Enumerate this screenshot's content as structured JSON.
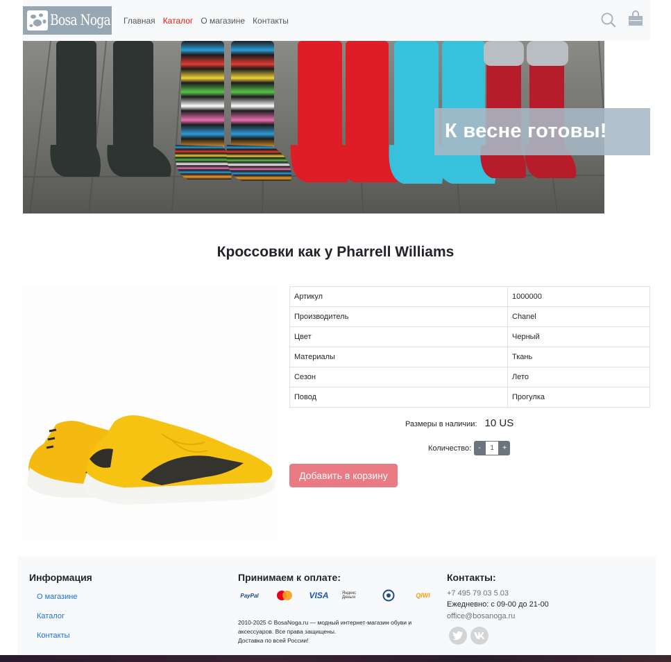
{
  "header": {
    "logo_text": "Bosa Noga",
    "nav": [
      {
        "label": "Главная",
        "active": false
      },
      {
        "label": "Каталог",
        "active": true
      },
      {
        "label": "О магазине",
        "active": false
      },
      {
        "label": "Контакты",
        "active": false
      }
    ],
    "icons": [
      "search-icon",
      "shopping-bag-icon"
    ]
  },
  "banner": {
    "text": "К весне готовы!"
  },
  "product": {
    "title": "Кроссовки как у Pharrell Williams",
    "specs": [
      {
        "key": "Артикул",
        "value": "1000000"
      },
      {
        "key": "Производитель",
        "value": "Chanel"
      },
      {
        "key": "Цвет",
        "value": "Черный"
      },
      {
        "key": "Материалы",
        "value": "Ткань"
      },
      {
        "key": "Сезон",
        "value": "Лето"
      },
      {
        "key": "Повод",
        "value": "Прогулка"
      }
    ],
    "sizes_label": "Размеры в наличии:",
    "size": "10 US",
    "quantity_label": "Количество:",
    "quantity_minus": "-",
    "quantity_value": "1",
    "quantity_plus": "+",
    "add_to_cart": "Добавить в корзину"
  },
  "footer": {
    "info_title": "Информация",
    "info_links": [
      "О магазине",
      "Каталог",
      "Контакты"
    ],
    "payment_title": "Принимаем к оплате:",
    "payment_methods": [
      "PayPal",
      "MasterCard",
      "VISA",
      "Яндекс Деньги",
      "WebMoney",
      "QIWI"
    ],
    "copyright": "2010-2025 © BosaNoga.ru — модный интернет-магазин обуви и аксессуаров. Все права защищены.",
    "delivery": "Доставка по всей России!",
    "contacts_title": "Контакты:",
    "phone": "+7 495 79 03 5 03",
    "hours": "Ежедневно: с 09-00 до 21-00",
    "email": "office@bosanoga.ru",
    "social": [
      "twitter-icon",
      "vk-icon"
    ]
  },
  "colors": {
    "accent_red": "#e5190e",
    "button_pink": "#ea7b85",
    "logo_bg": "#97a6b3",
    "link_blue": "#1a6fd9"
  }
}
